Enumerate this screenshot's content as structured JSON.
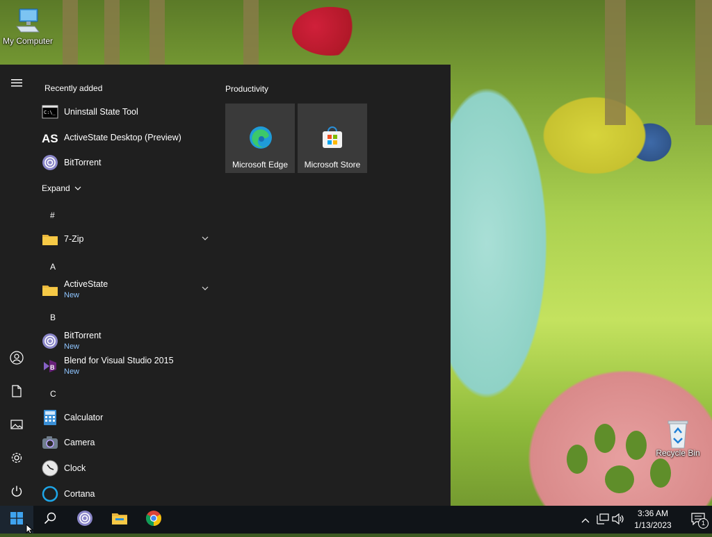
{
  "desktop": {
    "icons": [
      {
        "label": "My Computer"
      },
      {
        "label": "Recycle Bin"
      }
    ]
  },
  "start_menu": {
    "recently_added_title": "Recently added",
    "recently_added": [
      {
        "name": "Uninstall State Tool",
        "icon": "terminal-icon"
      },
      {
        "name": "ActiveState Desktop (Preview)",
        "icon": "activestate-icon"
      },
      {
        "name": "BitTorrent",
        "icon": "bittorrent-icon"
      }
    ],
    "expand_label": "Expand",
    "groups": [
      {
        "letter": "#",
        "apps": [
          {
            "name": "7-Zip",
            "badge": "",
            "icon": "folder-icon",
            "expandable": true
          }
        ]
      },
      {
        "letter": "A",
        "apps": [
          {
            "name": "ActiveState",
            "badge": "New",
            "icon": "folder-icon",
            "expandable": true
          }
        ]
      },
      {
        "letter": "B",
        "apps": [
          {
            "name": "BitTorrent",
            "badge": "New",
            "icon": "bittorrent-icon"
          },
          {
            "name": "Blend for Visual Studio 2015",
            "badge": "New",
            "icon": "visual-studio-blend-icon"
          }
        ]
      },
      {
        "letter": "C",
        "apps": [
          {
            "name": "Calculator",
            "badge": "",
            "icon": "calculator-icon"
          },
          {
            "name": "Camera",
            "badge": "",
            "icon": "camera-icon"
          },
          {
            "name": "Clock",
            "badge": "",
            "icon": "clock-icon"
          },
          {
            "name": "Cortana",
            "badge": "",
            "icon": "cortana-icon"
          }
        ]
      }
    ],
    "tiles_group_title": "Productivity",
    "tiles": [
      {
        "label": "Microsoft Edge",
        "icon": "edge-icon"
      },
      {
        "label": "Microsoft Store",
        "icon": "store-icon"
      }
    ],
    "rail": [
      "hamburger-icon",
      "user-icon",
      "documents-icon",
      "pictures-icon",
      "settings-icon",
      "power-icon"
    ]
  },
  "taskbar": {
    "time": "3:36 AM",
    "date": "1/13/2023",
    "notification_count": "1",
    "pinned": [
      "start-icon",
      "search-icon",
      "bittorrent-icon",
      "file-explorer-icon",
      "chrome-icon"
    ]
  },
  "colors": {
    "start_bg": "#1f1f1f",
    "tile_bg": "#3a3a3a",
    "new_badge": "#8ec5ff",
    "taskbar_bg": "#101418"
  }
}
